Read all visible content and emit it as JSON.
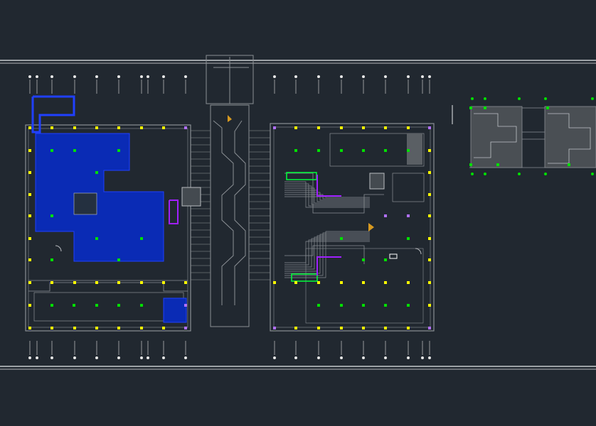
{
  "drawing": {
    "type": "cad-floor-plan",
    "background_color": "#212830",
    "colors": {
      "wall": "#8a8f94",
      "wall_light": "#b9bcc0",
      "border": "#e8eaec",
      "column_yellow": "#ffff00",
      "column_green": "#00e000",
      "column_purple": "#b070ff",
      "hatch_blue": "#0a2bb5",
      "hatch_blue_edge": "#2040ff",
      "highlight_green": "#00ff3a",
      "highlight_purple": "#a020ff",
      "symbol_cyan": "#40c8ff",
      "symbol_orange": "#d89a20",
      "axis_mark": "#e6e6e6"
    },
    "icons": [
      "column-marker",
      "grid-axis-bubble",
      "stair-arrow-icon",
      "door-swing-icon",
      "fixture-icon"
    ]
  }
}
